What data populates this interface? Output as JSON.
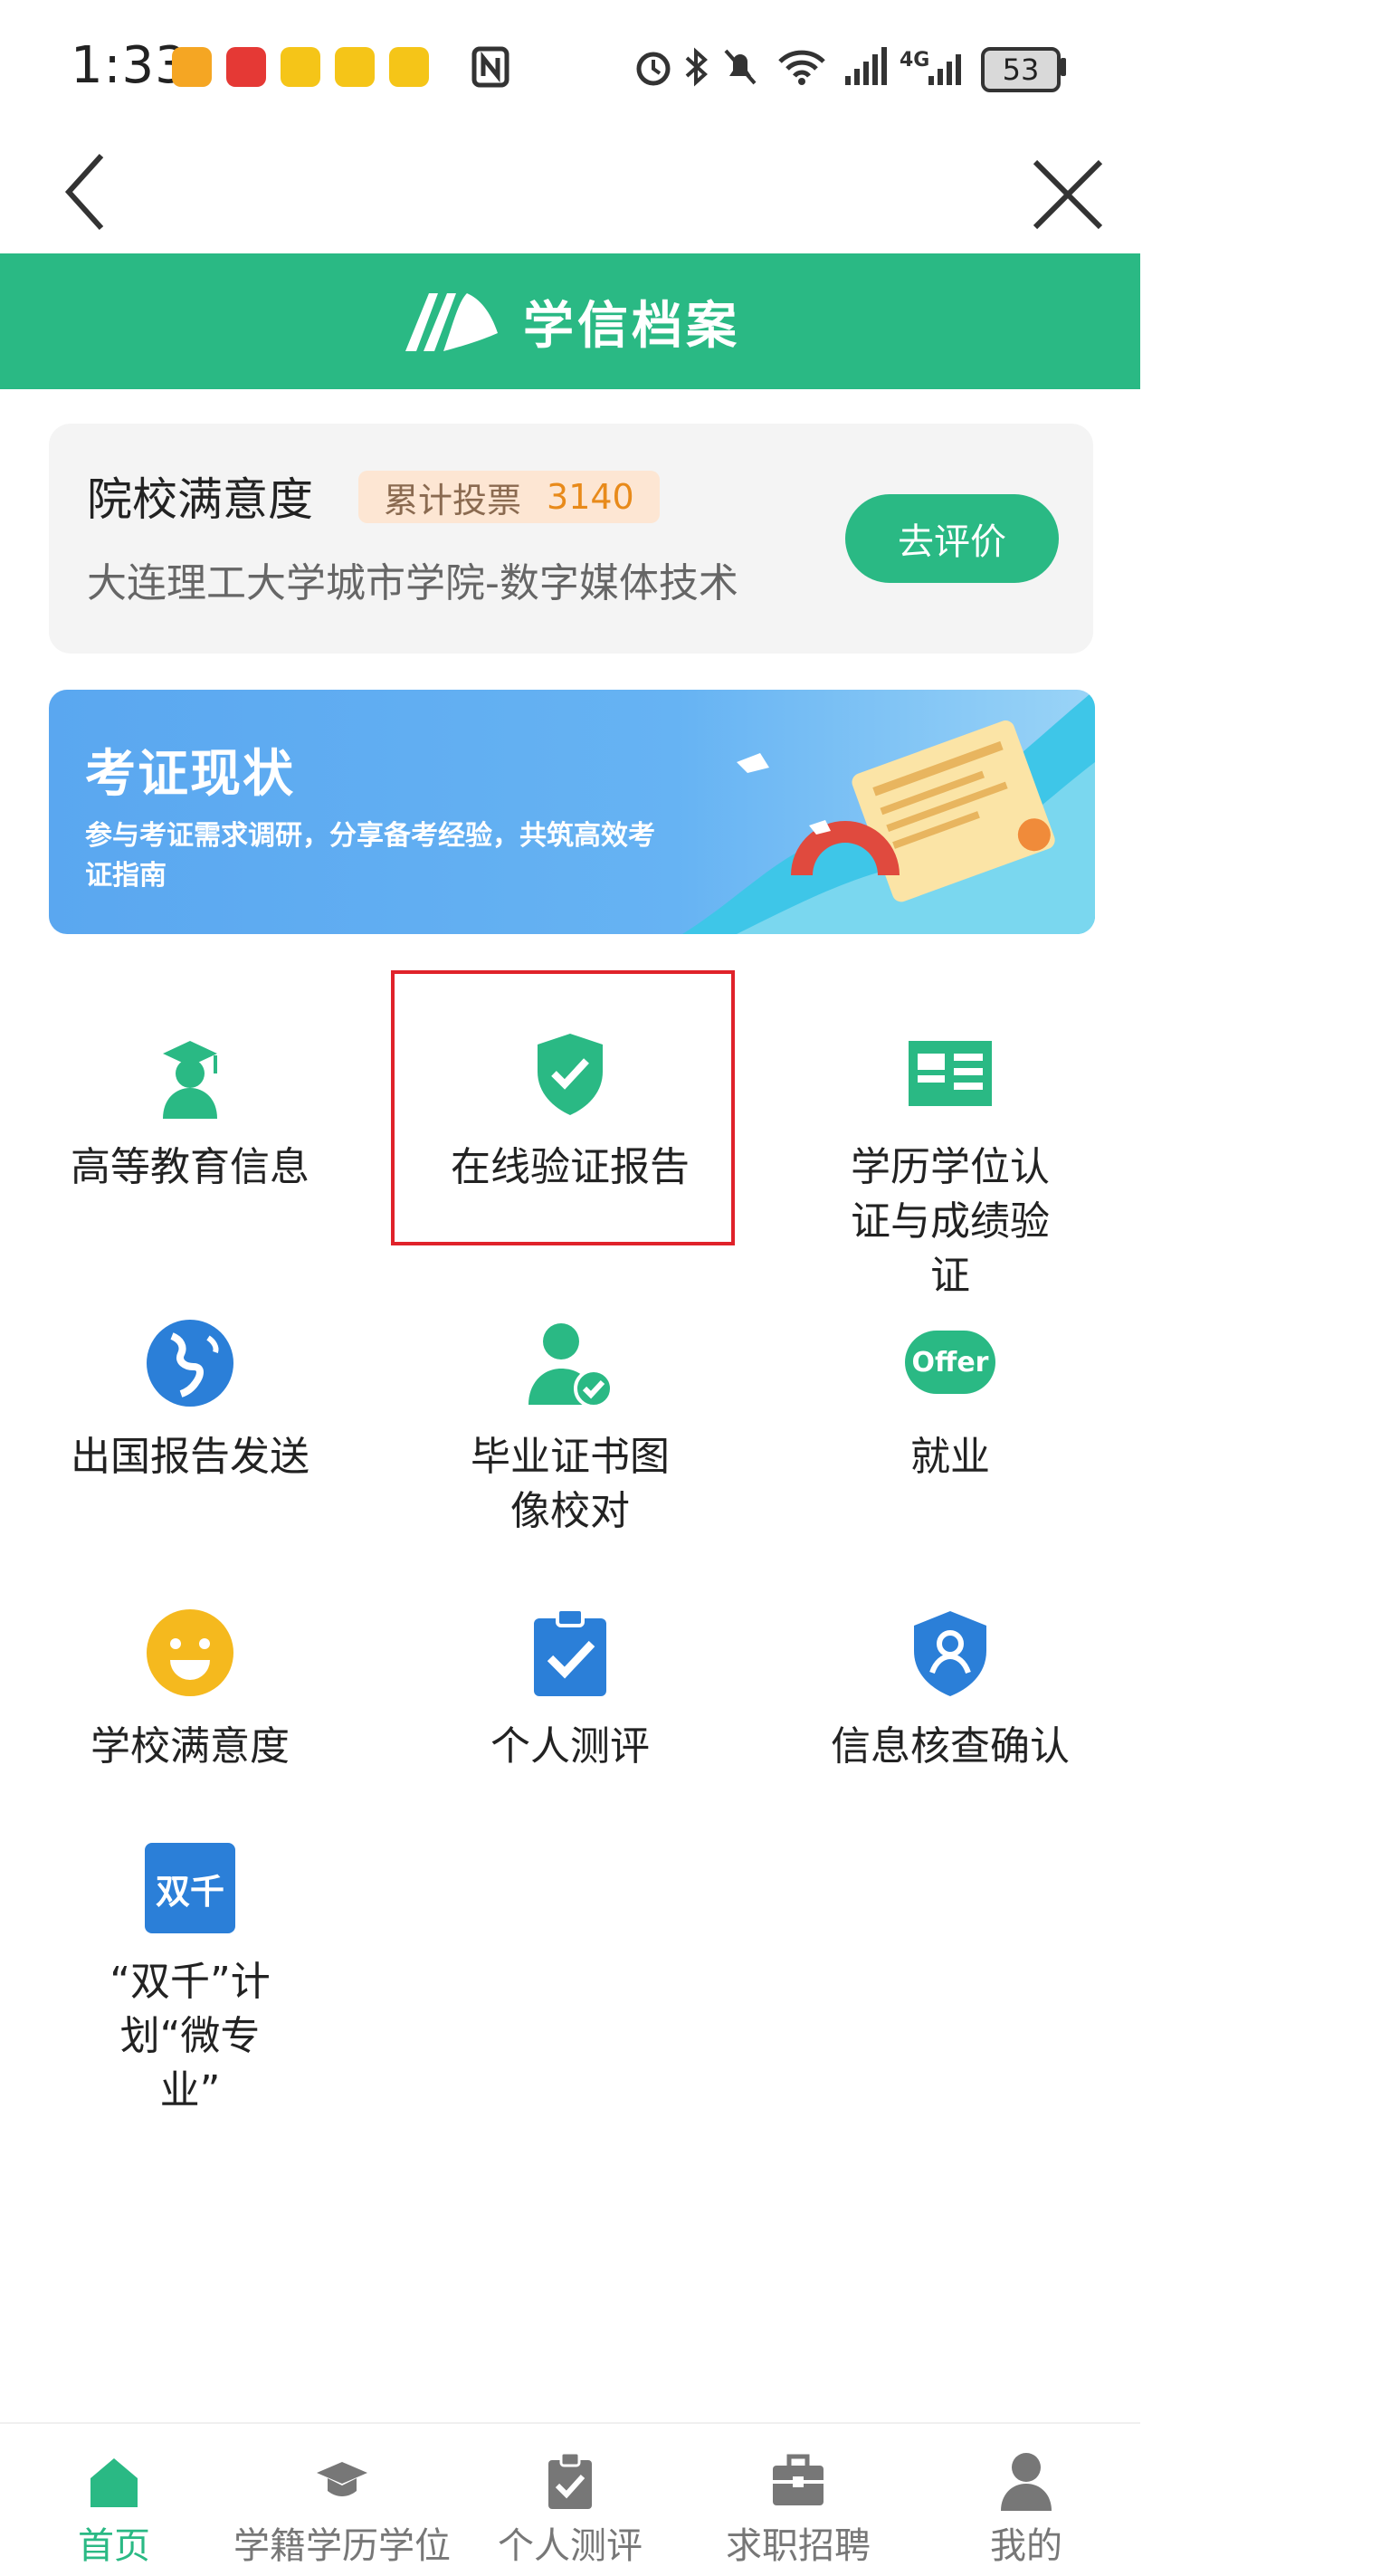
{
  "status_bar": {
    "time": "1:33",
    "battery": "53",
    "network": "4G"
  },
  "colors": {
    "brand": "#2ab984",
    "highlight": "#e0222a",
    "vote": "#e88a1a"
  },
  "header": {
    "brand_title": "学信档案"
  },
  "satisfaction_card": {
    "title": "院校满意度",
    "vote_label": "累计投票",
    "vote_count": "3140",
    "school": "大连理工大学城市学院-数字媒体技术",
    "button": "去评价"
  },
  "banner": {
    "title": "考证现状",
    "desc": "参与考证需求调研，分享备考经验，共筑高效考证指南"
  },
  "grid": [
    {
      "label": "高等教育信息",
      "icon": "graduate-icon"
    },
    {
      "label": "在线验证报告",
      "icon": "shield-check-icon"
    },
    {
      "label": "学历学位认证与成绩验证",
      "icon": "id-card-icon"
    },
    {
      "label": "出国报告发送",
      "icon": "globe-icon"
    },
    {
      "label": "毕业证书图像校对",
      "icon": "user-check-icon"
    },
    {
      "label": "就业",
      "icon": "offer-icon",
      "icon_text": "Offer"
    },
    {
      "label": "学校满意度",
      "icon": "smile-icon"
    },
    {
      "label": "个人测评",
      "icon": "clipboard-check-icon"
    },
    {
      "label": "信息核查确认",
      "icon": "shield-user-icon"
    },
    {
      "label": "“双千”计划“微专业”",
      "icon": "shuangqian-icon",
      "icon_text": "双千"
    }
  ],
  "bottom_nav": [
    {
      "label": "首页",
      "icon": "home-icon",
      "active": true
    },
    {
      "label": "学籍学历学位",
      "icon": "graduation-cap-icon"
    },
    {
      "label": "个人测评",
      "icon": "clipboard-check-icon"
    },
    {
      "label": "求职招聘",
      "icon": "briefcase-icon"
    },
    {
      "label": "我的",
      "icon": "person-icon"
    }
  ]
}
